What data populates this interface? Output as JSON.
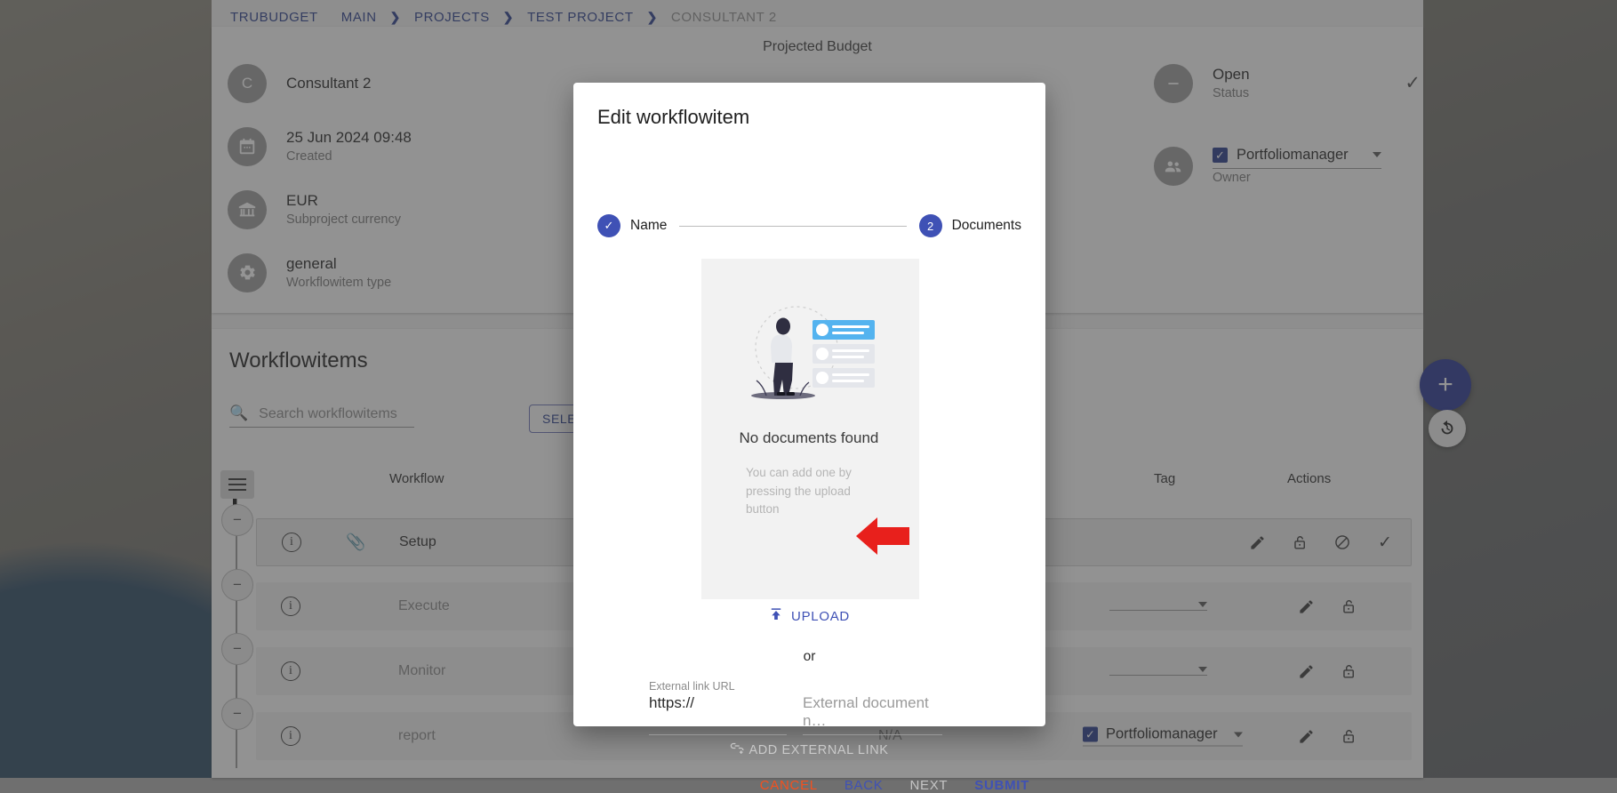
{
  "breadcrumb": {
    "items": [
      {
        "label": "TRUBUDGET",
        "active": true
      },
      {
        "label": "MAIN",
        "active": true
      },
      {
        "label": "PROJECTS",
        "active": true
      },
      {
        "label": "TEST PROJECT",
        "active": true
      },
      {
        "label": "CONSULTANT 2",
        "active": false
      }
    ],
    "separator": "❯"
  },
  "info_card": {
    "projected_budget_label": "Projected Budget",
    "left": [
      {
        "avatar": "C",
        "main": "Consultant 2",
        "sub": ""
      },
      {
        "avatar": "calendar-icon",
        "main": "25 Jun 2024 09:48",
        "sub": "Created"
      },
      {
        "avatar": "bank-icon",
        "main": "EUR",
        "sub": "Subproject currency"
      },
      {
        "avatar": "gear-icon",
        "main": "general",
        "sub": "Workflowitem type"
      }
    ],
    "right": {
      "status_main": "Open",
      "status_sub": "Status",
      "owner_name": "Portfoliomanager",
      "owner_sub": "Owner"
    }
  },
  "workflowitems": {
    "title": "Workflowitems",
    "search_placeholder": "Search workflowitems",
    "select_button": "SELECT",
    "columns": [
      "Workflow",
      "Tag",
      "Actions"
    ],
    "rows": [
      {
        "name": "Setup",
        "tag": "",
        "assignee": "",
        "dim": false,
        "has_clip": true,
        "actions": [
          "pencil-icon",
          "unlock-icon",
          "block-icon",
          "check-icon"
        ]
      },
      {
        "name": "Execute",
        "tag": "",
        "assignee": "",
        "dim": true,
        "has_clip": false,
        "actions": [
          "pencil-icon",
          "unlock-icon"
        ]
      },
      {
        "name": "Monitor",
        "tag": "",
        "assignee": "",
        "dim": true,
        "has_clip": false,
        "actions": [
          "pencil-icon",
          "unlock-icon"
        ]
      },
      {
        "name": "report",
        "tag": "N/A",
        "assignee": "Portfoliomanager",
        "dim": true,
        "has_clip": false,
        "actions": [
          "pencil-icon",
          "unlock-icon"
        ]
      }
    ]
  },
  "fab": {
    "add_label": "+",
    "history_label": "↺"
  },
  "dialog": {
    "title": "Edit workflowitem",
    "steps": [
      {
        "label": "Name",
        "marker": "✓",
        "state": "done"
      },
      {
        "label": "Documents",
        "marker": "2",
        "state": "active"
      }
    ],
    "empty_state": {
      "heading": "No documents found",
      "sub": "You can add one by pressing the upload button"
    },
    "upload_label": "UPLOAD",
    "or_label": "or",
    "external_link_label": "External link URL",
    "url_value": "https://",
    "doc_name_placeholder": "External document n…",
    "add_external_link_label": "ADD EXTERNAL LINK",
    "actions": [
      {
        "label": "CANCEL",
        "kind": "cancel"
      },
      {
        "label": "BACK",
        "kind": "back"
      },
      {
        "label": "NEXT",
        "kind": "next"
      },
      {
        "label": "SUBMIT",
        "kind": "submit"
      }
    ]
  },
  "annotation": {
    "arrow_color": "#e8201c"
  }
}
